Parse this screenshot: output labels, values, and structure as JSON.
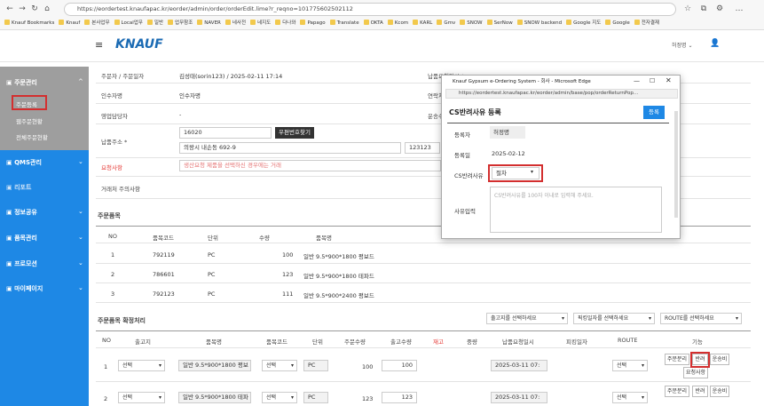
{
  "browser": {
    "url": "https://eordertest.knaufapac.kr/eorder/admin/order/orderEdit.lime?r_reqno=101775602502112",
    "bookmarks": [
      "Knauf Bookmarks",
      "Knauf",
      "본사업무",
      "Local업무",
      "일반",
      "업무참조",
      "NAVER",
      "네사전",
      "네지도",
      "다나와",
      "Papago",
      "Translate",
      "OKTA",
      "Kcom",
      "KARL",
      "Gmv",
      "SNOW",
      "SerNow",
      "SNOW backend",
      "Google 지도",
      "Google",
      "전자결재"
    ]
  },
  "header": {
    "logo": "KNAUF",
    "user": "허정명 ⌄"
  },
  "sidebar": {
    "menu": [
      {
        "label": "주문관리",
        "subs": [
          "주문등록",
          "웹주문현황",
          "전체주문현황"
        ]
      },
      {
        "label": "QMS관리"
      },
      {
        "label": "리포트"
      },
      {
        "label": "정보공유"
      },
      {
        "label": "품목관리"
      },
      {
        "label": "프로모션"
      },
      {
        "label": "마이페이지"
      }
    ]
  },
  "form": {
    "orderer_label": "주문자 / 주문일자",
    "orderer_value": "김성태(sorin123) / 2025-02-11 17:14",
    "due_label": "납품요청일시 *",
    "due_value": "2025-03-11 07:00",
    "receiver_label": "인수자명",
    "receiver_value": "인수자명",
    "contact_label": "연락처",
    "sales_label": "영업담당자",
    "sales_value": "-",
    "ship_label": "운송수",
    "addr_label": "납품주소 *",
    "zip": "16020",
    "zip_btn": "우편번호찾기",
    "addr1": "의왕시 내손동 692-9",
    "addr2": "123123",
    "req_label": "요청사항",
    "req_placeholder": "생산요청 제품을 선택하신 경우에는 거래",
    "note_label": "거래처 주의사항"
  },
  "items": {
    "title": "주문품목",
    "headers": [
      "NO",
      "품목코드",
      "단위",
      "수량",
      "품목명"
    ],
    "rows": [
      [
        "1",
        "792119",
        "PC",
        "100",
        "일반 9.5*900*1800 평보드"
      ],
      [
        "2",
        "786601",
        "PC",
        "123",
        "일반 9.5*900*1800 테파드"
      ],
      [
        "3",
        "792123",
        "PC",
        "111",
        "일반 9.5*900*2400 평보드"
      ]
    ]
  },
  "confirm": {
    "title": "주문품목 확정처리",
    "filter_wh": "출고지를 선택하세요",
    "filter_date": "픽킹일자를 선택하세요",
    "filter_route": "ROUTE를 선택하세요",
    "headers": [
      "NO",
      "출고지",
      "품목명",
      "품목코드",
      "단위",
      "주문수량",
      "출고수량",
      "재고",
      "중량",
      "납품요청일시",
      "피킹일자",
      "ROUTE",
      "기능"
    ],
    "select": "선택",
    "rows": [
      {
        "no": "1",
        "name": "일반 9.5*900*1800 평보",
        "unit": "PC",
        "qty": "100",
        "out": "100",
        "date": "2025-03-11 07:"
      },
      {
        "no": "2",
        "name": "일반 9.5*900*1800 테파",
        "unit": "PC",
        "qty": "123",
        "out": "123",
        "date": "2025-03-11 07:"
      }
    ],
    "btn_split": "주문분리",
    "btn_return": "반려",
    "btn_ship": "운송비",
    "btn_note": "요청사항"
  },
  "popup": {
    "window_title": "Knauf Gypsum e-Ordering System - 회사 - Microsoft Edge",
    "url": "https://eordertest.knaufapac.kr/eorder/admin/base/pop/orderReturnPop...",
    "title": "CS반려사유 등록",
    "register": "등록",
    "writer_label": "등록자",
    "writer": "허정명",
    "date_label": "등록일",
    "date": "2025-02-12",
    "reason_label": "CS반려사유",
    "reason": "절차",
    "input_label": "사유입력",
    "input_placeholder": "CS반려사유를 100자 이내로 입력해 주세요."
  }
}
